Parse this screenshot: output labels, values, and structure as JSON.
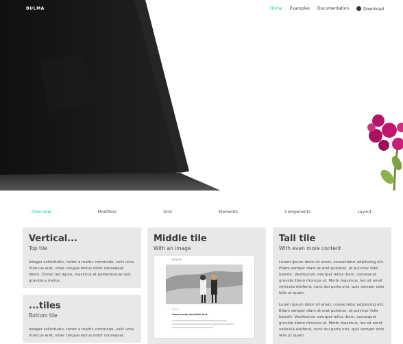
{
  "navbar": {
    "brand": "BULMA",
    "links": [
      {
        "label": "Home",
        "active": true
      },
      {
        "label": "Examples",
        "active": false
      },
      {
        "label": "Documentation",
        "active": false
      },
      {
        "label": "Download",
        "active": false,
        "icon": "github-icon"
      }
    ]
  },
  "tabs": [
    "Overview",
    "Modifiers",
    "Grid",
    "Elements",
    "Components",
    "Layout"
  ],
  "active_tab": "Overview",
  "tiles": {
    "vertical": {
      "title": "Vertical...",
      "subtitle": "Top tile",
      "text": "Integer sollicitudin, tortor a mattis commodo, velit urna rhoncus erat, vitae congue lectus dolor consequat libero. Donec leo ligula, maximus et pellentesque sed, gravida a metus."
    },
    "tiles": {
      "title": "...tiles",
      "subtitle": "Bottom tile",
      "text": "Integer sollicitudin, tortor a mattis commodo, velit urna rhoncus erat, vitae congue lectus dolor consequat"
    },
    "middle": {
      "title": "Middle tile",
      "subtitle": "With an image",
      "mock": {
        "brand": "BULMA",
        "label": "Bulma",
        "heading": "Some really beautiful text."
      }
    },
    "tall": {
      "title": "Tall tile",
      "subtitle": "With even more content",
      "paragraphs": [
        "Lorem ipsum dolor sit amet, consectetur adipiscing elit. Etiam semper diam at erat pulvinar, at pulvinar felis blandit. Vestibulum volutpat tellus diam, consequat gravida libero rhoncus ut. Morbi maximus, leo sit amet vehicula eleifend, nunc dui porta orci, quis semper odio felis ut quam.",
        "Lorem ipsum dolor sit amet, consectetur adipiscing elit. Etiam semper diam at erat pulvinar, at pulvinar felis blandit. Vestibulum volutpat tellus diam, consequat gravida libero rhoncus ut. Morbi maximus, leo sit amet vehicula eleifend, nunc dui porta orci, quis semper odio felis ut quam."
      ]
    }
  },
  "colors": {
    "accent": "#00c4a7",
    "tile_bg": "#e8e8e8",
    "hero_dark": "#141414",
    "flower": "#c0166f"
  }
}
